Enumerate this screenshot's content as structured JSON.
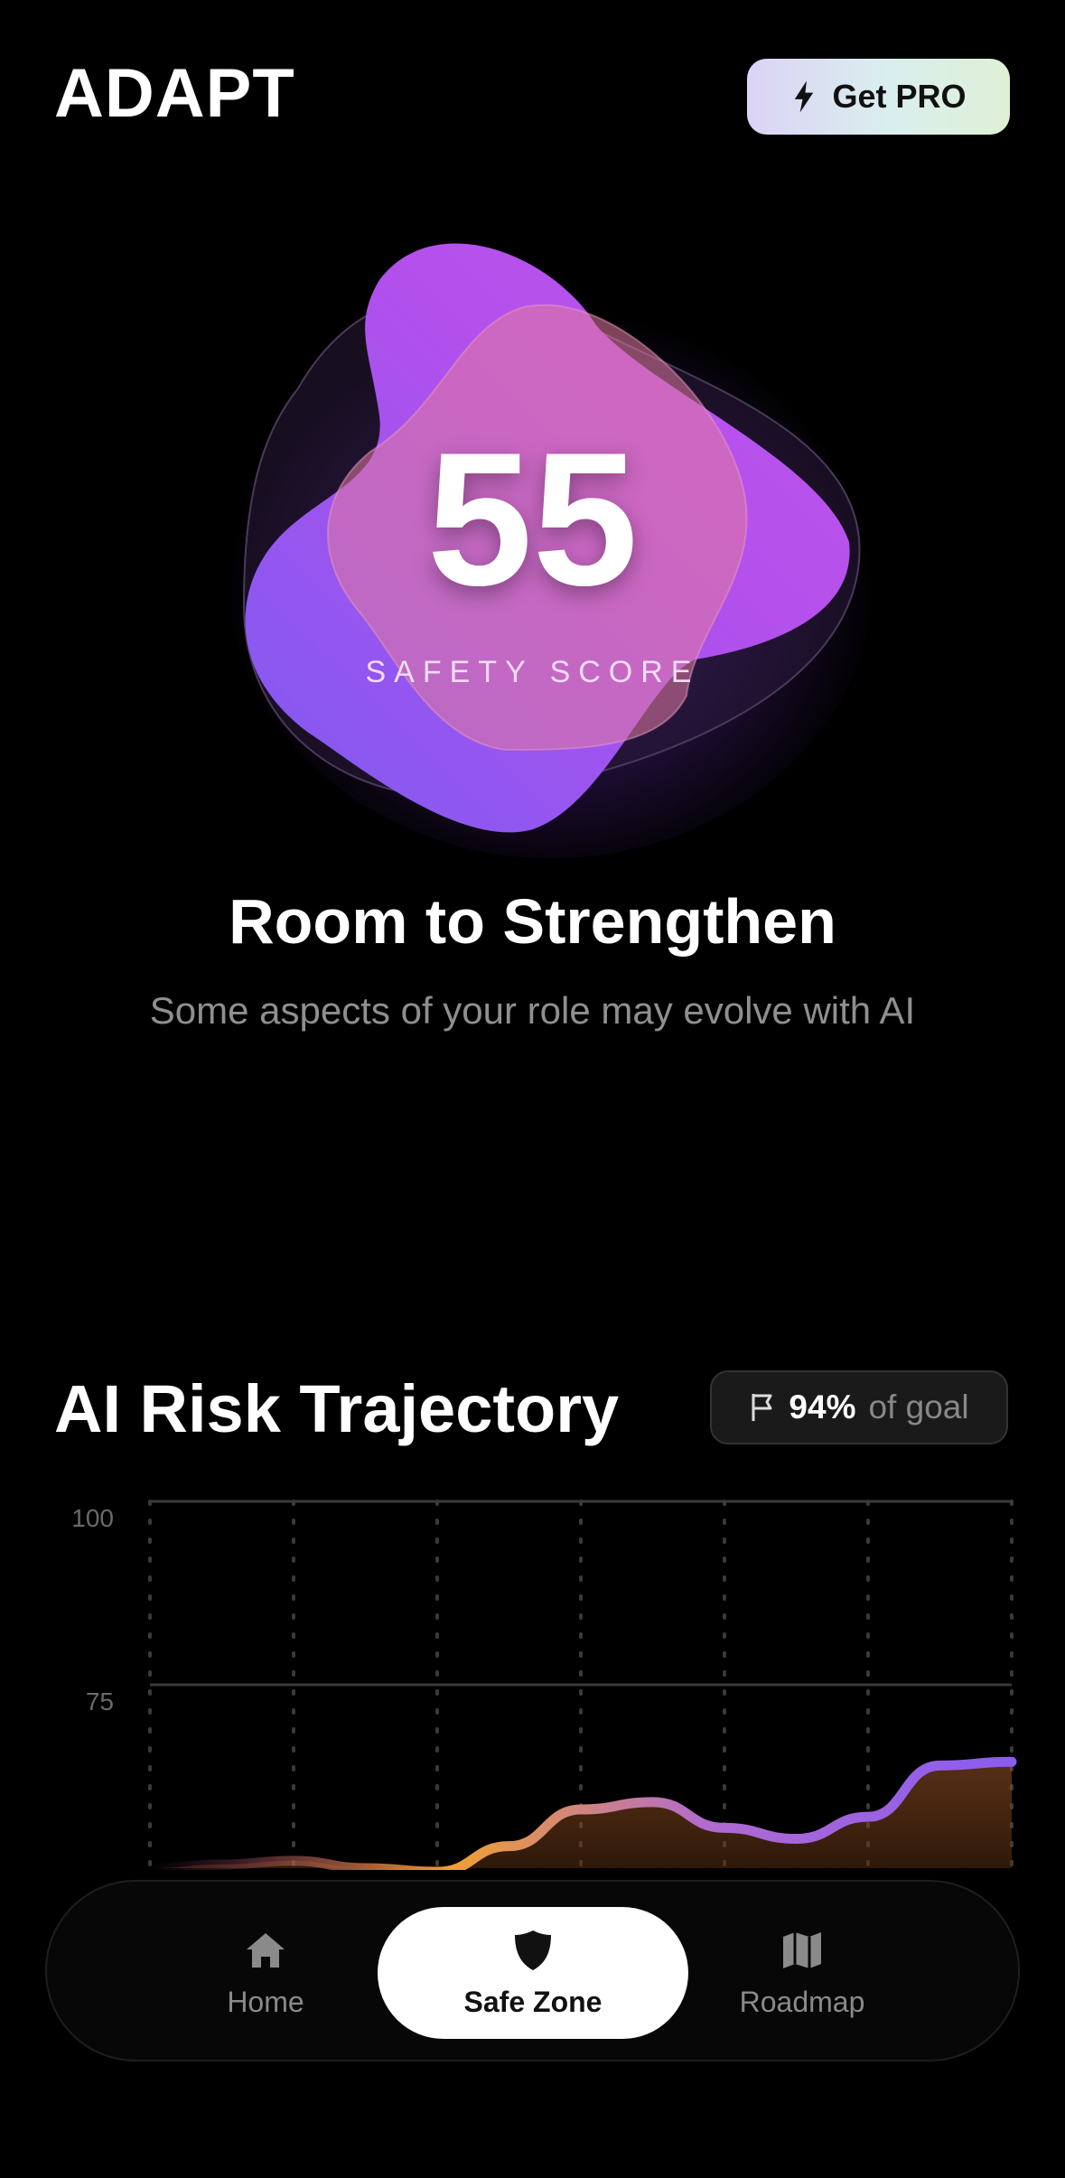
{
  "app": {
    "logo": "ADAPT"
  },
  "header": {
    "pro_button_label": "Get PRO",
    "pro_icon": "bolt-icon"
  },
  "hero": {
    "score": "55",
    "score_label": "SAFETY SCORE",
    "headline": "Room to Strengthen",
    "subtitle": "Some aspects of your role may evolve with AI",
    "colors": {
      "blob_main": "#b04ff0",
      "blob_inner": "#d66aa8",
      "blob_edge": "#7a55f0"
    }
  },
  "trajectory": {
    "title": "AI Risk Trajectory",
    "goal_value": "94%",
    "goal_suffix": "of goal",
    "goal_icon": "flag-icon"
  },
  "chart_data": {
    "type": "area",
    "title": "",
    "xlabel": "",
    "ylabel": "",
    "y_ticks": [
      "100",
      "75"
    ],
    "ylim": [
      50,
      100
    ],
    "grid": true,
    "x": [
      0,
      1,
      2,
      3,
      4,
      5,
      6,
      7,
      8,
      9,
      10,
      11,
      12
    ],
    "series": [
      {
        "values": [
          50,
          50.5,
          51,
          50,
          49.5,
          53,
          58,
          59,
          55.5,
          54,
          57,
          64,
          64.5
        ]
      }
    ],
    "colors": [
      "#f0a030",
      "#b06ad0",
      "#8a5cf0"
    ]
  },
  "nav": {
    "items": [
      {
        "label": "Home",
        "icon": "home-icon"
      },
      {
        "label": "Safe Zone",
        "icon": "shield-icon"
      },
      {
        "label": "Roadmap",
        "icon": "map-icon"
      }
    ],
    "active": "Safe Zone"
  }
}
